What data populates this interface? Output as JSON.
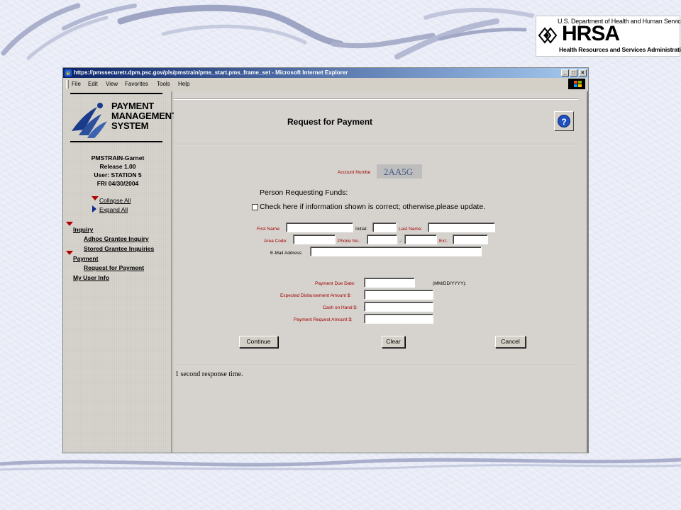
{
  "slide": {
    "hrsa_logo": {
      "department": "U.S. Department of Health and Human Services",
      "wordmark": "HRSA",
      "subtitle": "Health Resources and Services Administration"
    }
  },
  "window": {
    "title": "https://pmssecuretr.dpm.psc.gov/pls/pmstrain/pms_start.pms_frame_set - Microsoft Internet Explorer",
    "controls": {
      "minimize": "_",
      "maximize": "□",
      "close": "×"
    },
    "menu": [
      "File",
      "Edit",
      "View",
      "Favorites",
      "Tools",
      "Help"
    ]
  },
  "sidebar": {
    "logo_lines": [
      "PAYMENT",
      "MANAGEMENT",
      "SYSTEM"
    ],
    "session": [
      "PMSTRAIN-Garnet",
      "Release 1.00",
      "User: STATION 5",
      "FRI 04/30/2004"
    ],
    "collapse_all": "Collapse All",
    "expand_all": "Expand All",
    "nav": {
      "inquiry": "Inquiry",
      "adhoc_inquiry": "Adhoc Grantee Inquiry",
      "stored_inquiries": "Stored Grantee Inquiries",
      "payment": "Payment",
      "request_for_payment": "Request for Payment",
      "my_user_info": "My User Info"
    }
  },
  "form": {
    "title": "Request for Payment",
    "help_icon": "help-icon",
    "account_label": "Account Numbe",
    "account_value": "2AA5G",
    "person_heading": "Person Requesting Funds:",
    "confirm_text": "Check here if information shown is correct; otherwise,please update.",
    "labels": {
      "first_name": "First Name:",
      "initial": "Initial:",
      "last_name": "Last Name:",
      "area_code": "Area Code:",
      "phone": "Phone No.:",
      "dash": "-:",
      "ext": "Ext.:",
      "email": "E-Mail Address:",
      "due_date": "Payment Due Date:",
      "date_format": "(MM/DD/YYYY):",
      "expected_amount": "Expected Disbursement Amount $:",
      "cash_on_hand": "Cash on Hand $:",
      "request_amount": "Payment Request Amount $:"
    },
    "buttons": {
      "continue": "Continue",
      "clear": "Clear",
      "cancel": "Cancel"
    },
    "response_time": "1 second response time."
  },
  "colors": {
    "titlebar": "#0a246a",
    "required_label": "#a00000",
    "frame_bg": "#d6d3ce"
  }
}
